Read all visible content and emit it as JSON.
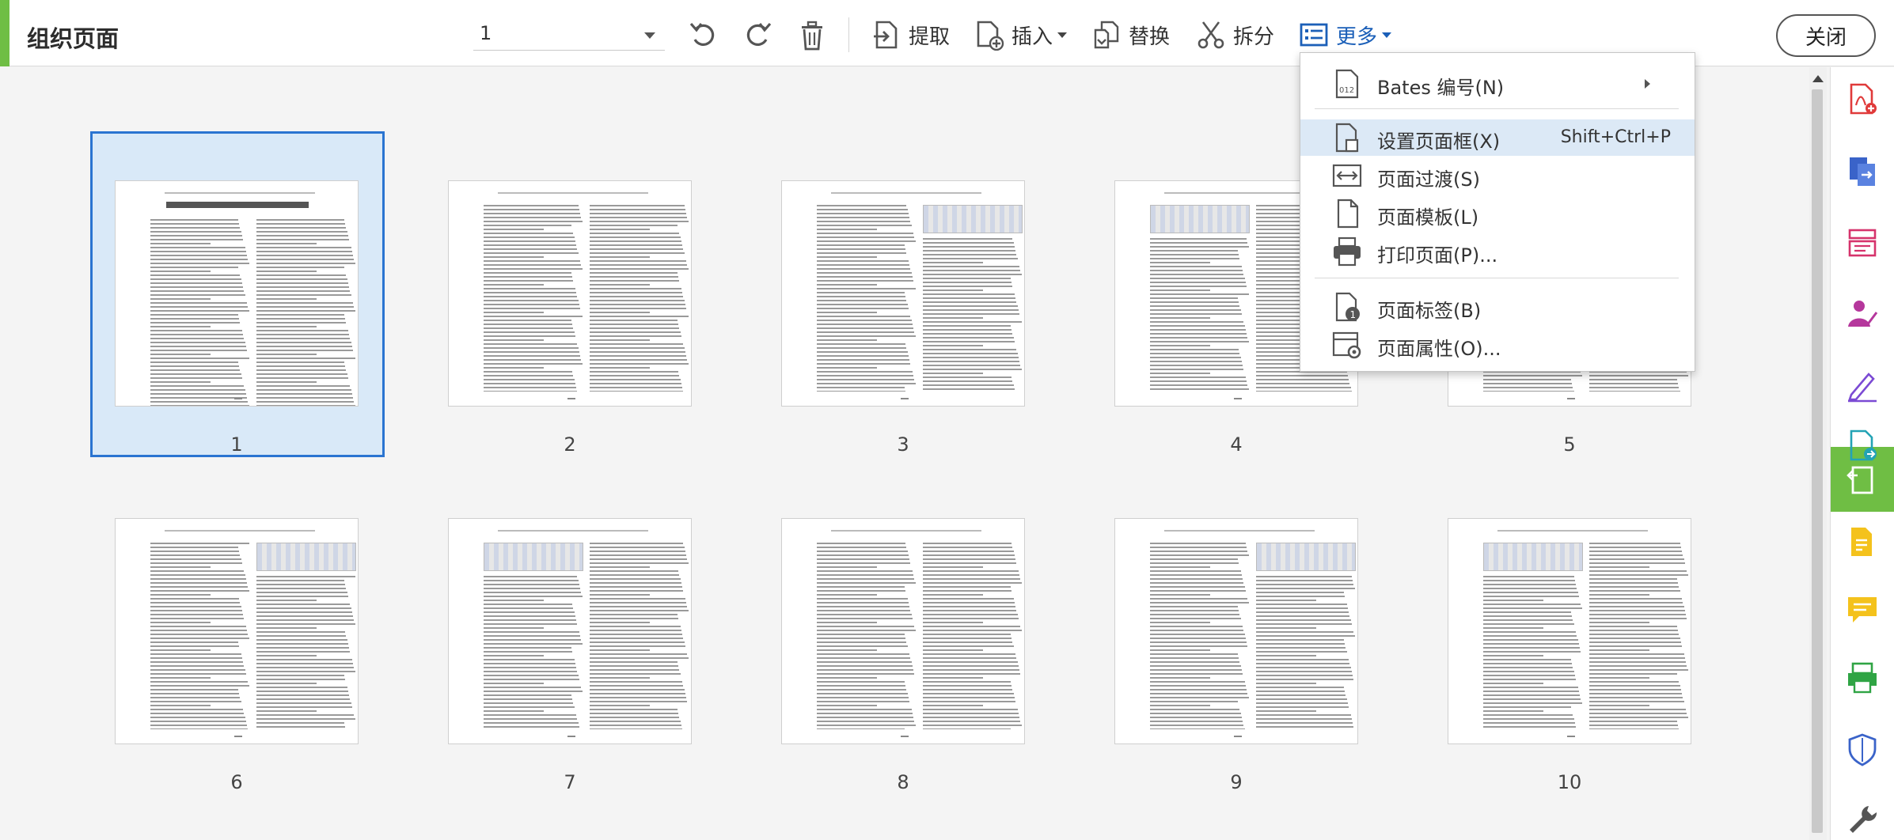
{
  "toolbar": {
    "title": "组织页面",
    "page_input": "1",
    "extract_label": "提取",
    "insert_label": "插入",
    "replace_label": "替换",
    "split_label": "拆分",
    "more_label": "更多",
    "close_label": "关闭"
  },
  "menu": {
    "items": [
      {
        "label": "Bates 编号(N)",
        "shortcut": "",
        "icon": "bates-number-icon"
      },
      {
        "label": "设置页面框(X)",
        "shortcut": "Shift+Ctrl+P",
        "icon": "page-box-icon"
      },
      {
        "label": "页面过渡(S)",
        "shortcut": "",
        "icon": "page-transition-icon"
      },
      {
        "label": "页面模板(L)",
        "shortcut": "",
        "icon": "page-template-icon"
      },
      {
        "label": "打印页面(P)...",
        "shortcut": "",
        "icon": "print-icon"
      },
      {
        "label": "页面标签(B)",
        "shortcut": "",
        "icon": "page-label-icon"
      },
      {
        "label": "页面属性(O)...",
        "shortcut": "",
        "icon": "page-properties-icon"
      }
    ]
  },
  "pages": [
    {
      "label": "1",
      "selected": true
    },
    {
      "label": "2"
    },
    {
      "label": "3"
    },
    {
      "label": "4"
    },
    {
      "label": "5"
    },
    {
      "label": "6"
    },
    {
      "label": "7"
    },
    {
      "label": "8"
    },
    {
      "label": "9"
    },
    {
      "label": "10"
    }
  ],
  "colors": {
    "accent_green": "#6fbe44",
    "selection_blue": "#2a74d1",
    "more_blue": "#1b5fb8"
  }
}
